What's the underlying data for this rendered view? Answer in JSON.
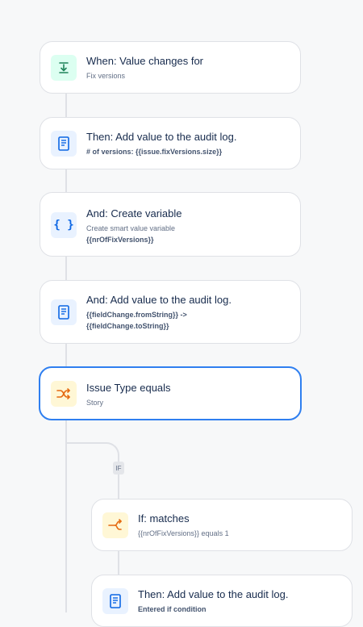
{
  "steps": [
    {
      "title": "When: Value changes for",
      "sub": "Fix versions",
      "icon": "download-arrow-icon"
    },
    {
      "title": "Then: Add value to the audit log.",
      "sub": "# of versions: {{issue.fixVersions.size}}",
      "icon": "document-icon"
    },
    {
      "title": "And: Create variable",
      "sub": "Create smart value variable",
      "sub2": "{{nrOfFixVersions}}",
      "icon": "braces-icon"
    },
    {
      "title": "And: Add value to the audit log.",
      "sub": "{{fieldChange.fromString}} ->",
      "sub2": "{{fieldChange.toString}}",
      "icon": "document-icon"
    },
    {
      "title": "Issue Type equals",
      "sub": "Story",
      "icon": "shuffle-icon"
    }
  ],
  "branch": {
    "badge": "IF",
    "steps": [
      {
        "title": "If: matches",
        "sub": "{{nrOfFixVersions}} equals 1",
        "icon": "branch-icon"
      },
      {
        "title": "Then: Add value to the audit log.",
        "sub": "Entered if condition",
        "icon": "document-icon"
      }
    ]
  },
  "colors": {
    "accent": "#2f7ff0",
    "trigger": "#1f845a",
    "action": "#0c66e4",
    "condition": "#e56910"
  }
}
